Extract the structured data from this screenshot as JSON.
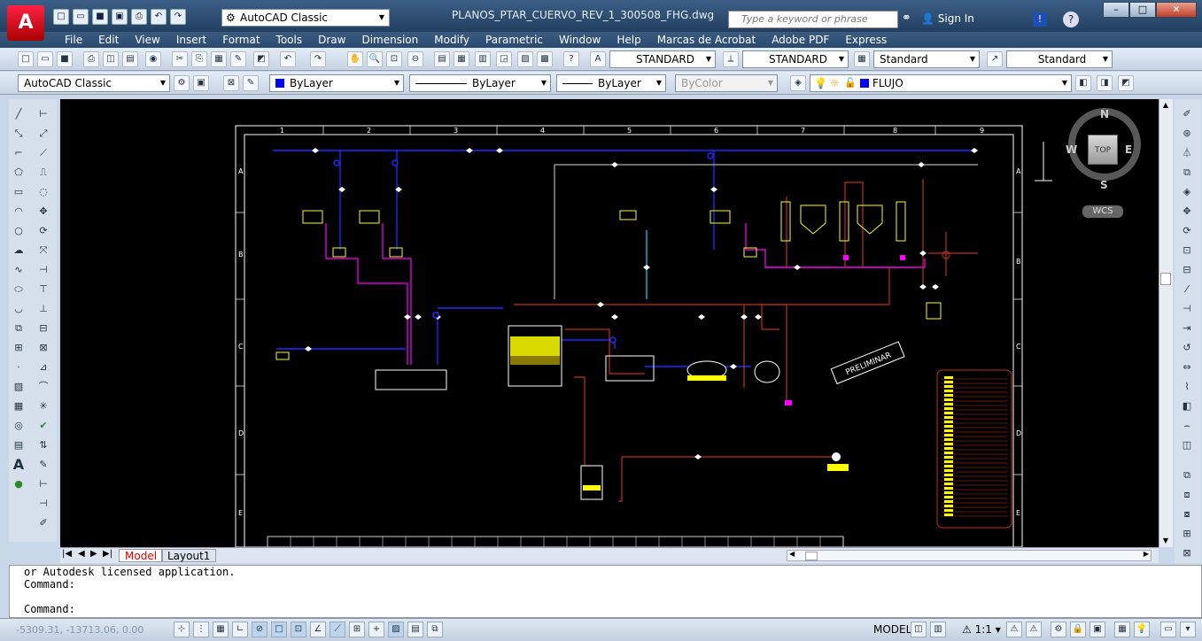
{
  "app": {
    "logo": "A"
  },
  "title": {
    "workspace": "AutoCAD Classic",
    "document": "PLANOS_PTAR_CUERVO_REV_1_300508_FHG.dwg",
    "search_placeholder": "Type a keyword or phrase",
    "signin": "Sign In"
  },
  "menu": [
    "File",
    "Edit",
    "View",
    "Insert",
    "Format",
    "Tools",
    "Draw",
    "Dimension",
    "Modify",
    "Parametric",
    "Window",
    "Help",
    "Marcas de Acrobat",
    "Adobe PDF",
    "Express"
  ],
  "styles": {
    "text_style": "STANDARD",
    "dim_style": "STANDARD",
    "table_style": "Standard",
    "multileader_style": "Standard"
  },
  "properties": {
    "workspace": "AutoCAD Classic",
    "color": "ByLayer",
    "linetype": "ByLayer",
    "lineweight": "ByLayer",
    "plotstyle": "ByColor",
    "layer": "FLUJO"
  },
  "viewcube": {
    "n": "N",
    "s": "S",
    "e": "E",
    "w": "W",
    "face": "TOP",
    "ucs": "WCS"
  },
  "tabs": {
    "model": "Model",
    "layout": "Layout1"
  },
  "command": {
    "line1": "or Autodesk licensed application.",
    "line2": "Command:",
    "line3": "Command:"
  },
  "status": {
    "coords": "-5309.31, -13713.06, 0.00",
    "space": "MODEL",
    "scale": "1:1"
  },
  "drawing": {
    "col_labels": [
      "1",
      "2",
      "3",
      "4",
      "5",
      "6",
      "7",
      "8",
      "9"
    ],
    "row_labels": [
      "A",
      "B",
      "C",
      "D",
      "E"
    ],
    "stamp": "PRELIMINAR"
  },
  "colors": {
    "frame": "#ffffff",
    "blue": "#1a2cff",
    "magenta": "#ff00ff",
    "red": "#c0301a",
    "cyan": "#00e0ff",
    "yellow": "#ffff00",
    "grey": "#b0b0b0"
  }
}
